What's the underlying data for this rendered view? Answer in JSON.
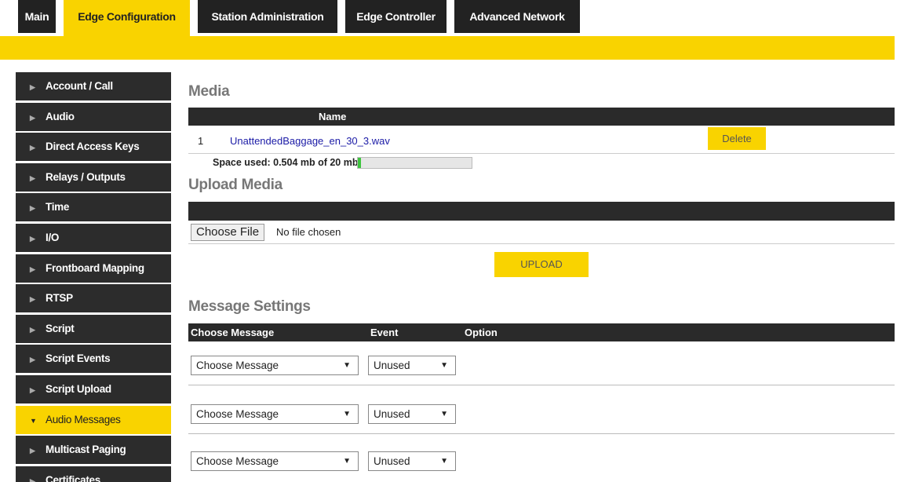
{
  "nav": {
    "tabs": [
      {
        "label": "Main"
      },
      {
        "label": "Edge Configuration"
      },
      {
        "label": "Station Administration"
      },
      {
        "label": "Edge Controller"
      },
      {
        "label": "Advanced Network"
      }
    ],
    "active_tab": "Edge Configuration"
  },
  "sidebar": {
    "items": [
      {
        "label": "Account / Call"
      },
      {
        "label": "Audio"
      },
      {
        "label": "Direct Access Keys"
      },
      {
        "label": "Relays / Outputs"
      },
      {
        "label": "Time"
      },
      {
        "label": "I/O"
      },
      {
        "label": "Frontboard Mapping"
      },
      {
        "label": "RTSP"
      },
      {
        "label": "Script"
      },
      {
        "label": "Script Events"
      },
      {
        "label": "Script Upload"
      },
      {
        "label": "Audio Messages"
      },
      {
        "label": "Multicast Paging"
      },
      {
        "label": "Certificates"
      }
    ],
    "active_item": "Audio Messages"
  },
  "media": {
    "title": "Media",
    "column_name": "Name",
    "rows": [
      {
        "index": "1",
        "name": "UnattendedBaggage_en_30_3.wav",
        "delete_label": "Delete"
      }
    ],
    "space_used_label": "Space used: 0.504 mb of 20 mb",
    "space_used_fraction": 0.025
  },
  "upload": {
    "title": "Upload Media",
    "choose_file_label": "Choose File",
    "no_file_text": "No file chosen",
    "upload_label": "UPLOAD"
  },
  "message_settings": {
    "title": "Message Settings",
    "columns": [
      "Choose Message",
      "Event",
      "Option"
    ],
    "rows": [
      {
        "message": "Choose Message",
        "event": "Unused"
      },
      {
        "message": "Choose Message",
        "event": "Unused"
      },
      {
        "message": "Choose Message",
        "event": "Unused"
      }
    ]
  },
  "colors": {
    "accent": "#f9d300",
    "dark": "#2c2c2c",
    "link": "#1a1aa6",
    "progress": "#3ec43e"
  }
}
